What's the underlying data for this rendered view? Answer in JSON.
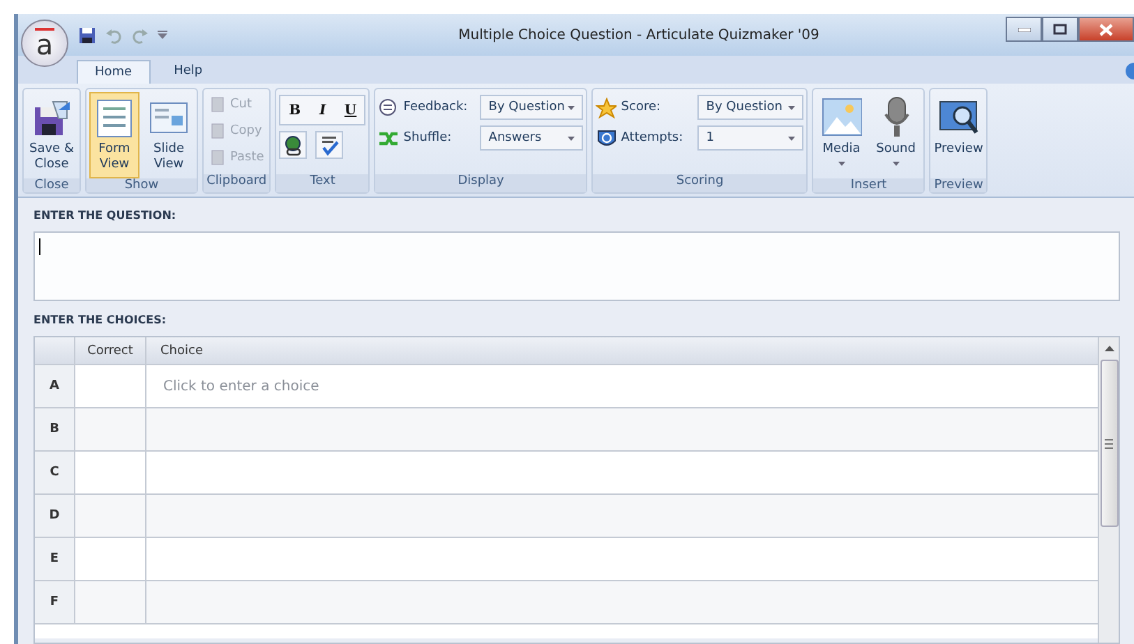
{
  "window": {
    "title": "Multiple Choice Question - Articulate Quizmaker '09",
    "logo": "a"
  },
  "tabs": [
    {
      "label": "Home",
      "selected": true
    },
    {
      "label": "Help",
      "selected": false
    }
  ],
  "ribbon": {
    "groups": [
      {
        "label": "Close",
        "items": [
          {
            "kind": "large",
            "label": "Save & Close",
            "selected": false
          }
        ]
      },
      {
        "label": "Show",
        "items": [
          {
            "kind": "large",
            "label": "Form View",
            "selected": true
          },
          {
            "kind": "large",
            "label": "Slide View",
            "selected": false
          }
        ]
      },
      {
        "label": "Clipboard",
        "items": [
          {
            "kind": "small",
            "label": "Cut",
            "disabled": true
          },
          {
            "kind": "small",
            "label": "Copy",
            "disabled": true
          },
          {
            "kind": "small",
            "label": "Paste",
            "disabled": true
          }
        ]
      },
      {
        "label": "Text",
        "items": [
          {
            "kind": "format",
            "labels": [
              "B",
              "I",
              "U"
            ]
          },
          {
            "kind": "icon_button"
          },
          {
            "kind": "icon_button"
          }
        ]
      },
      {
        "label": "Display",
        "items": [
          {
            "kind": "dropdown",
            "label": "Feedback:",
            "value": "By Question"
          },
          {
            "kind": "dropdown",
            "label": "Shuffle:",
            "value": "Answers"
          }
        ]
      },
      {
        "label": "Scoring",
        "items": [
          {
            "kind": "dropdown",
            "label": "Score:",
            "value": "By Question"
          },
          {
            "kind": "dropdown",
            "label": "Attempts:",
            "value": "1"
          }
        ]
      },
      {
        "label": "Insert",
        "items": [
          {
            "kind": "large",
            "label": "Media",
            "selected": false,
            "has_menu": true
          },
          {
            "kind": "large",
            "label": "Sound",
            "selected": false,
            "has_menu": true
          }
        ]
      },
      {
        "label": "Preview",
        "items": [
          {
            "kind": "large",
            "label": "Preview",
            "selected": false
          }
        ]
      }
    ]
  },
  "question": {
    "label": "ENTER THE QUESTION:"
  },
  "choices": {
    "label": "ENTER THE CHOICES:",
    "columns": [
      "Correct",
      "Choice"
    ],
    "rows": [
      {
        "letter": "A",
        "placeholder": "Click to enter a choice"
      },
      {
        "letter": "B"
      },
      {
        "letter": "C"
      },
      {
        "letter": "D"
      },
      {
        "letter": "E"
      },
      {
        "letter": "F"
      }
    ]
  }
}
